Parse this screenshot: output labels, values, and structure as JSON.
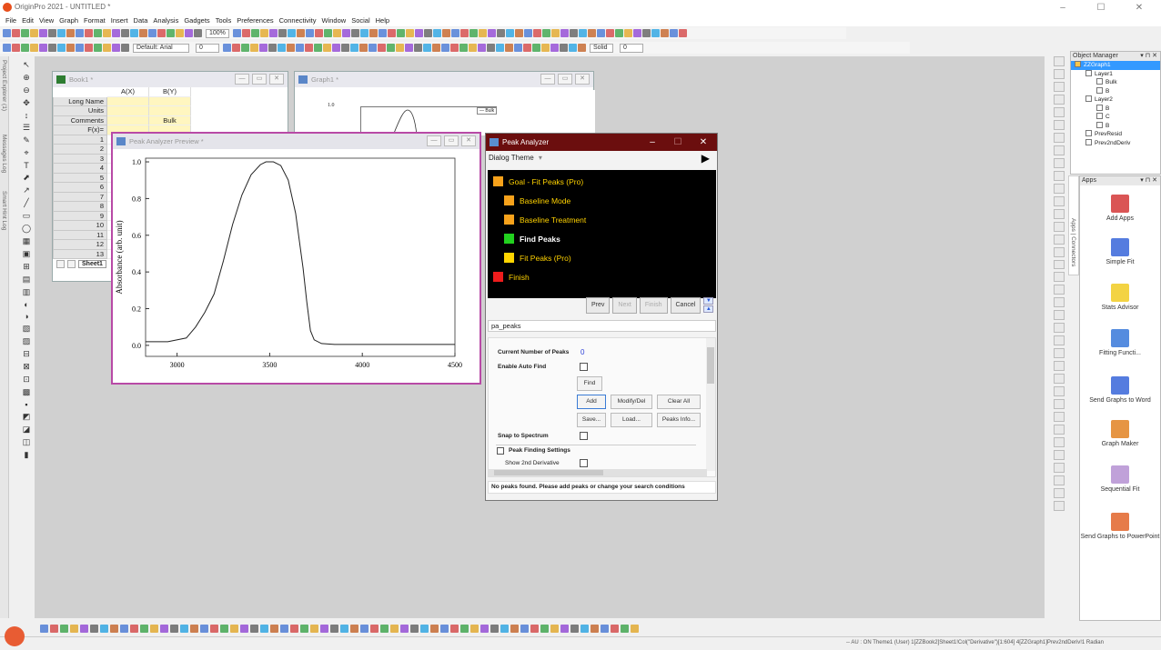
{
  "app": {
    "title": "OriginPro 2021 - UNTITLED *"
  },
  "window_controls": {
    "minimize": "–",
    "maximize": "☐",
    "close": "✕"
  },
  "menu": [
    "File",
    "Edit",
    "View",
    "Graph",
    "Format",
    "Insert",
    "Data",
    "Analysis",
    "Gadgets",
    "Tools",
    "Preferences",
    "Connectivity",
    "Window",
    "Social",
    "Help"
  ],
  "toolbar": {
    "zoom": "100%",
    "font": "Default: Arial",
    "font_size": "0",
    "line_style": "Solid",
    "line_width": "0"
  },
  "left_dock": {
    "tabs": [
      "Project Explorer (1)",
      "Messages Log",
      "Smart Hint Log"
    ]
  },
  "book1": {
    "title": "Book1 *",
    "columns": [
      "A(X)",
      "B(Y)"
    ],
    "meta_rows": [
      {
        "label": "Long Name",
        "a": "",
        "b": ""
      },
      {
        "label": "Units",
        "a": "",
        "b": ""
      },
      {
        "label": "Comments",
        "a": "",
        "b": "Bulk"
      },
      {
        "label": "F(x)=",
        "a": "",
        "b": ""
      }
    ],
    "row_numbers": [
      "1",
      "2",
      "3",
      "4",
      "5",
      "6",
      "7",
      "8",
      "9",
      "10",
      "11",
      "12",
      "13"
    ],
    "sheet_tab": "Sheet1"
  },
  "graph1": {
    "title": "Graph1 *",
    "legend": "Bulk",
    "ytick": "1.0"
  },
  "preview": {
    "title": "Peak Analyzer Preview *",
    "ylabel": "Absorbance (arb. unit)",
    "yticks": [
      "1.0",
      "0.8",
      "0.6",
      "0.4",
      "0.2",
      "0.0"
    ],
    "xticks": [
      "3000",
      "3500",
      "4000",
      "4500"
    ]
  },
  "chart_data": {
    "type": "line",
    "title": "",
    "xlabel": "",
    "ylabel": "Absorbance (arb. unit)",
    "xlim": [
      2830,
      4500
    ],
    "ylim": [
      -0.06,
      1.02
    ],
    "x": [
      2830,
      2950,
      3050,
      3100,
      3150,
      3200,
      3250,
      3300,
      3350,
      3400,
      3450,
      3480,
      3500,
      3520,
      3560,
      3600,
      3640,
      3680,
      3700,
      3720,
      3740,
      3780,
      3850,
      4000,
      4200,
      4500
    ],
    "y": [
      0.02,
      0.02,
      0.04,
      0.1,
      0.18,
      0.28,
      0.46,
      0.66,
      0.82,
      0.93,
      0.985,
      1.0,
      1.0,
      1.0,
      0.98,
      0.9,
      0.72,
      0.42,
      0.24,
      0.08,
      0.03,
      0.01,
      0.005,
      0.005,
      0.005,
      0.005
    ]
  },
  "peak_analyzer": {
    "title": "Peak Analyzer",
    "dialog_theme_label": "Dialog Theme",
    "steps": [
      {
        "label": "Goal - Fit Peaks (Pro)",
        "color": "#f7a21b",
        "text_color": "#ffd200"
      },
      {
        "label": "Baseline Mode",
        "color": "#f7a21b",
        "text_color": "#ffd200"
      },
      {
        "label": "Baseline Treatment",
        "color": "#f7a21b",
        "text_color": "#ffd200"
      },
      {
        "label": "Find Peaks",
        "color": "#22d11f",
        "text_color": "#ffffff"
      },
      {
        "label": "Fit Peaks (Pro)",
        "color": "#ffd500",
        "text_color": "#ffd200"
      },
      {
        "label": "Finish",
        "color": "#ee1c1c",
        "text_color": "#ffd200"
      }
    ],
    "nav": {
      "prev": "Prev",
      "next": "Next",
      "finish": "Finish",
      "cancel": "Cancel"
    },
    "name_value": "pa_peaks",
    "current_peaks_label": "Current Number of Peaks",
    "current_peaks_value": "0",
    "auto_find_label": "Enable Auto Find",
    "buttons": {
      "find": "Find",
      "add": "Add",
      "modify": "Modify/Del",
      "clear": "Clear All",
      "save": "Save...",
      "load": "Load...",
      "info": "Peaks Info..."
    },
    "snap_label": "Snap to Spectrum",
    "peak_settings_label": "Peak Finding Settings",
    "show_2nd_label": "Show 2nd Derivative",
    "status": "No peaks found. Please add peaks or change your search conditions"
  },
  "object_manager": {
    "title": "Object Manager",
    "tree": [
      {
        "label": "ZZGraph1",
        "level": 0,
        "selected": true
      },
      {
        "label": "Layer1",
        "level": 1
      },
      {
        "label": "Bulk",
        "level": 2
      },
      {
        "label": "B",
        "level": 2
      },
      {
        "label": "Layer2",
        "level": 1
      },
      {
        "label": "B",
        "level": 2
      },
      {
        "label": "C",
        "level": 2
      },
      {
        "label": "B",
        "level": 2
      },
      {
        "label": "PrevResid",
        "level": 1
      },
      {
        "label": "Prev2ndDeriv",
        "level": 1
      }
    ]
  },
  "apps": {
    "title": "Apps",
    "side_tab": "Apps | Connectors",
    "items": [
      {
        "label": "Add Apps",
        "icon": "add-apps-icon"
      },
      {
        "label": "Simple Fit",
        "icon": "simple-fit-icon"
      },
      {
        "label": "Stats Advisor",
        "icon": "stats-advisor-icon"
      },
      {
        "label": "Fitting Functi...",
        "icon": "fitting-functions-icon"
      },
      {
        "label": "Send Graphs to Word",
        "icon": "send-to-word-icon"
      },
      {
        "label": "Graph Maker",
        "icon": "graph-maker-icon"
      },
      {
        "label": "Sequential Fit",
        "icon": "sequential-fit-icon"
      },
      {
        "label": "Send Graphs to PowerPoint",
        "icon": "send-to-powerpoint-icon"
      }
    ]
  },
  "statusbar": {
    "text": "-- AU : ON Theme1 (User) 1[ZZBook2]Sheet1!Col(\"Derivative\")[1:604] 4[ZZGraph1]Prev2ndDeriv!1 Radian"
  }
}
